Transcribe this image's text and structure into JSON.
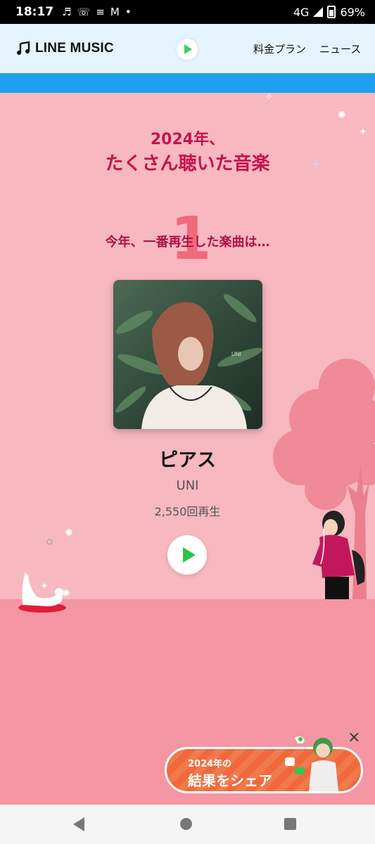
{
  "status_bar": {
    "time": "18:17",
    "network": "4G",
    "battery": "69%",
    "icons": [
      "music-note-icon",
      "missed-call-icon",
      "message-icon",
      "gmail-icon",
      "dot-icon"
    ]
  },
  "app_header": {
    "brand": "LINE MUSIC",
    "nav": [
      "料金プラン",
      "ニュース"
    ]
  },
  "recap": {
    "year_line": "2024年、",
    "title_line": "たくさん聴いた音楽",
    "rank_number": "1",
    "rank_text": "今年、一番再生した楽曲は…",
    "song": {
      "title": "ピアス",
      "artist": "UNI",
      "plays": "2,550回再生"
    }
  },
  "share_banner": {
    "line1": "2024年の",
    "line2": "結果をシェア",
    "close": "×"
  },
  "colors": {
    "accent": "#c4134f",
    "background": "#f7b8c0",
    "floor": "#f496a4",
    "play_green": "#31c24c",
    "header_bg": "#e5f3fd",
    "strip_blue": "#1fa0ee",
    "share_orange": "#f2683c"
  }
}
